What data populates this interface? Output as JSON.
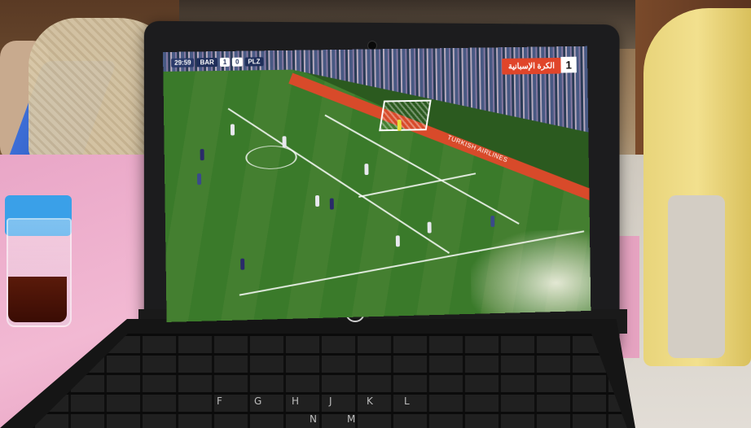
{
  "screen": {
    "scorebug": {
      "time": "29:59",
      "home_team": "BAR",
      "home_score": "1",
      "away_score": "0",
      "away_team": "PLZ"
    },
    "channel": {
      "name": "الكرة الإسبانية",
      "number": "1"
    },
    "advertising_board": "TURKISH AIRLINES"
  },
  "laptop": {
    "logo": "hp"
  },
  "keyboard": {
    "keys": [
      "F",
      "G",
      "H",
      "J",
      "K",
      "L",
      "N",
      "M"
    ]
  }
}
